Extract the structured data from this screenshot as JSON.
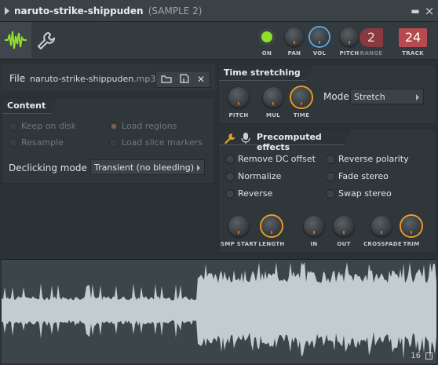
{
  "window": {
    "title": "naruto-strike-shippuden",
    "subtitle": "(SAMPLE 2)",
    "minimize": "▬",
    "close": "×"
  },
  "toolbar": {
    "on_label": "ON",
    "pan_label": "PAN",
    "vol_label": "VOL",
    "pitch_label": "PITCH",
    "range_label": "RANGE",
    "range_value": "2",
    "track_label": "TRACK",
    "track_value": "24"
  },
  "file": {
    "label": "File",
    "name": "naruto-strike-shippuden",
    "ext": ".mp3",
    "browse_icon": "folder-icon",
    "save_icon": "save-icon",
    "remove_icon": "close-icon",
    "remove_glyph": "✕"
  },
  "content": {
    "header": "Content",
    "keep_on_disk": "Keep on disk",
    "resample": "Resample",
    "load_regions": "Load regions",
    "load_slice_markers": "Load slice markers",
    "declicking_label": "Declicking mode",
    "declicking_value": "Transient (no bleeding)"
  },
  "time_stretching": {
    "header": "Time stretching",
    "pitch_label": "PITCH",
    "mul_label": "MUL",
    "time_label": "TIME",
    "mode_label": "Mode",
    "mode_value": "Stretch"
  },
  "precomputed": {
    "header": "Precomputed effects",
    "remove_dc": "Remove DC offset",
    "normalize": "Normalize",
    "reverse": "Reverse",
    "reverse_polarity": "Reverse polarity",
    "fade_stereo": "Fade stereo",
    "swap_stereo": "Swap stereo",
    "knobs": [
      "SMP START",
      "LENGTH",
      "IN",
      "OUT",
      "CROSSFADE",
      "TRIM"
    ]
  },
  "waveform": {
    "corner_label": "16"
  }
}
